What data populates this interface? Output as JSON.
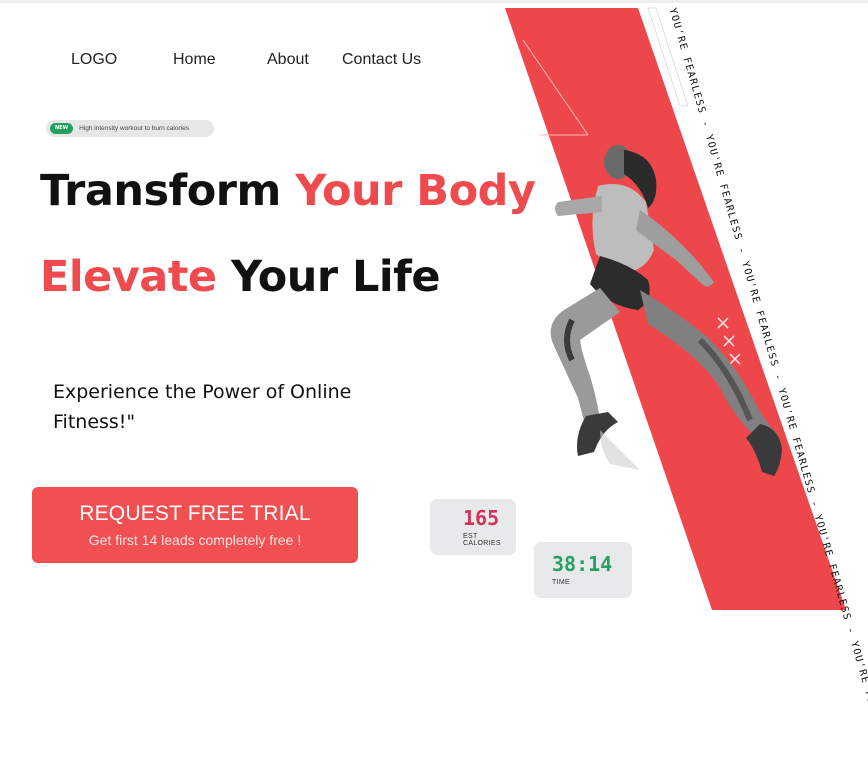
{
  "nav": {
    "logo": "LOGO",
    "items": [
      "Home",
      "About",
      "Contact Us"
    ]
  },
  "pill": {
    "badge": "NEW",
    "text": "High intensity workout to burn calories"
  },
  "headline": {
    "line1_dark": "Transform ",
    "line1_red": "Your Body",
    "line2_red": "Elevate ",
    "line2_dark": "Your Life"
  },
  "subheadline": "Experience the Power of Online Fitness!\"",
  "cta": {
    "title": "REQUEST FREE TRIAL",
    "subtitle": "Get first 14 leads completely free !"
  },
  "stats": {
    "calories": {
      "value": "165",
      "label": "EST CALORIES"
    },
    "time": {
      "value": "38:14",
      "label": "TIME"
    }
  },
  "slogan": "YOU'RE FEARLESS - YOU'RE FEARLESS - YOU'RE FEARLESS - YOU'RE FEARLESS - YOU'RE FEARLESS - YOU'RE FEARLESS -",
  "colors": {
    "accent": "#ef4b4f",
    "band": "#ee474b",
    "time_value": "#27a065",
    "calories_value": "#d0325a"
  },
  "hero_image": "runner-photo"
}
